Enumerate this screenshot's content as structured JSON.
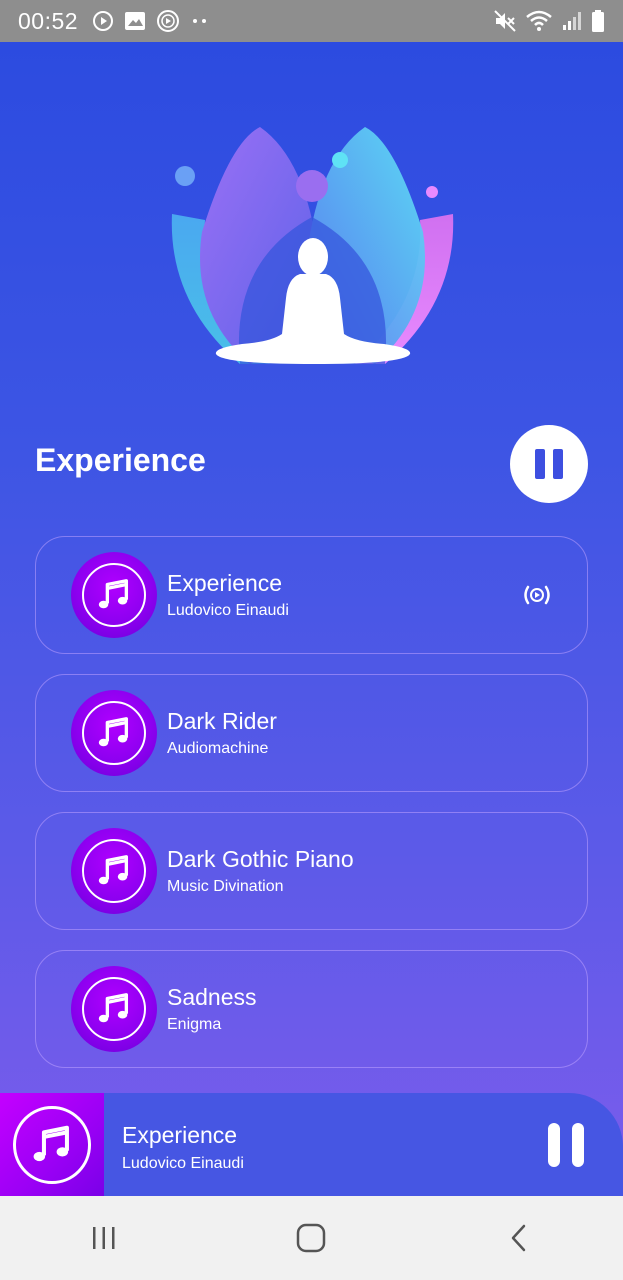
{
  "status_bar": {
    "time": "00:52",
    "left_icons": [
      "play-circle-icon",
      "image-icon",
      "media-icon",
      "more-dots-icon"
    ],
    "right_icons": [
      "mute-icon",
      "wifi-icon",
      "signal-icon",
      "battery-icon"
    ]
  },
  "header": {
    "title": "Experience"
  },
  "tracks": [
    {
      "title": "Experience",
      "artist": "Ludovico Einaudi",
      "playing": true
    },
    {
      "title": "Dark Rider",
      "artist": "Audiomachine",
      "playing": false
    },
    {
      "title": "Dark Gothic Piano",
      "artist": "Music Divination",
      "playing": false
    },
    {
      "title": "Sadness",
      "artist": "Enigma",
      "playing": false
    }
  ],
  "now_playing": {
    "title": "Experience",
    "artist": "Ludovico Einaudi"
  },
  "colors": {
    "background_top": "#2c4be0",
    "background_bottom": "#7c5cec",
    "disc_purple": "#9a00f5",
    "now_bar": "#4656e3"
  }
}
